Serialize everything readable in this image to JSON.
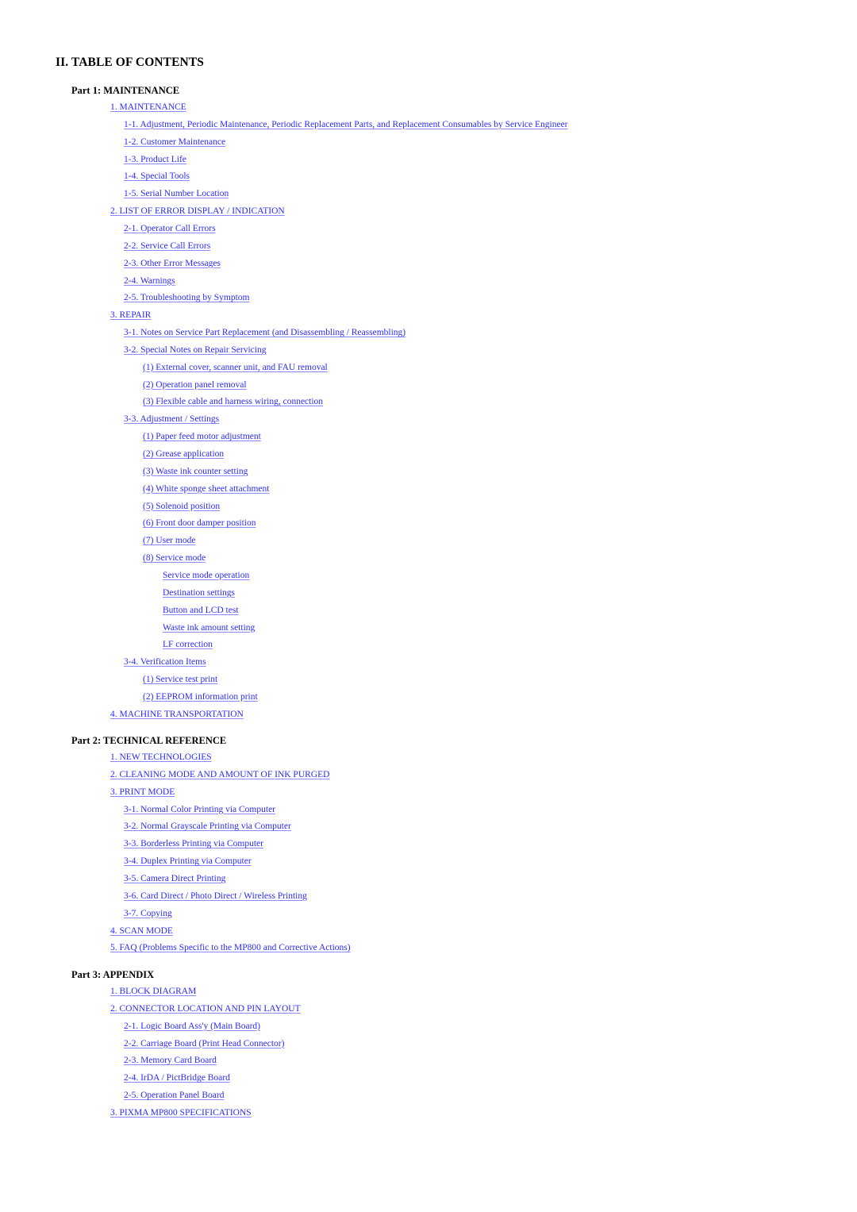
{
  "title": "II.  TABLE OF CONTENTS",
  "link_color": "#2a2aff",
  "parts": [
    {
      "label": "Part 1:  MAINTENANCE",
      "entries": [
        {
          "level": 1,
          "text": "1.  MAINTENANCE"
        },
        {
          "level": 2,
          "text": "1-1. Adjustment, Periodic Maintenance, Periodic Replacement Parts, and Replacement Consumables by Service Engineer"
        },
        {
          "level": 2,
          "text": "1-2.  Customer Maintenance"
        },
        {
          "level": 2,
          "text": "1-3.  Product Life"
        },
        {
          "level": 2,
          "text": "1-4.  Special Tools"
        },
        {
          "level": 2,
          "text": "1-5.  Serial Number Location"
        },
        {
          "level": 1,
          "text": "2.  LIST OF ERROR DISPLAY / INDICATION"
        },
        {
          "level": 2,
          "text": "2-1.  Operator Call Errors"
        },
        {
          "level": 2,
          "text": "2-2.  Service Call Errors"
        },
        {
          "level": 2,
          "text": "2-3.  Other Error Messages"
        },
        {
          "level": 2,
          "text": "2-4.  Warnings"
        },
        {
          "level": 2,
          "text": "2-5.  Troubleshooting by Symptom"
        },
        {
          "level": 1,
          "text": "3.  REPAIR"
        },
        {
          "level": 2,
          "text": "3-1.  Notes on Service Part Replacement (and Disassembling / Reassembling)"
        },
        {
          "level": 2,
          "text": "3-2.  Special Notes on Repair Servicing"
        },
        {
          "level": 3,
          "text": "(1)  External cover, scanner unit, and FAU removal"
        },
        {
          "level": 3,
          "text": "(2)  Operation panel removal"
        },
        {
          "level": 3,
          "text": "(3)  Flexible cable and harness wiring, connection"
        },
        {
          "level": 2,
          "text": "3-3.  Adjustment / Settings"
        },
        {
          "level": 3,
          "text": "(1)  Paper feed motor adjustment"
        },
        {
          "level": 3,
          "text": "(2)  Grease application"
        },
        {
          "level": 3,
          "text": "(3)  Waste ink counter setting"
        },
        {
          "level": 3,
          "text": "(4)  White sponge sheet attachment"
        },
        {
          "level": 3,
          "text": "(5)  Solenoid position"
        },
        {
          "level": 3,
          "text": "(6)  Front door damper position"
        },
        {
          "level": 3,
          "text": "(7)  User mode"
        },
        {
          "level": 3,
          "text": "(8)  Service mode"
        },
        {
          "level": 4,
          "text": "Service mode operation"
        },
        {
          "level": 4,
          "text": "Destination settings"
        },
        {
          "level": 4,
          "text": "Button and LCD test"
        },
        {
          "level": 4,
          "text": "Waste ink amount setting"
        },
        {
          "level": 4,
          "text": "LF correction"
        },
        {
          "level": 2,
          "text": "3-4.  Verification Items"
        },
        {
          "level": 3,
          "text": "(1)  Service test print"
        },
        {
          "level": 3,
          "text": "(2)  EEPROM information print"
        },
        {
          "level": 1,
          "text": "4.  MACHINE TRANSPORTATION"
        }
      ]
    },
    {
      "label": "Part 2:  TECHNICAL REFERENCE",
      "entries": [
        {
          "level": 1,
          "text": "1.  NEW TECHNOLOGIES"
        },
        {
          "level": 1,
          "text": "2.  CLEANING MODE AND AMOUNT OF INK PURGED"
        },
        {
          "level": 1,
          "text": "3.  PRINT MODE"
        },
        {
          "level": 2,
          "text": "3-1.  Normal Color Printing via Computer"
        },
        {
          "level": 2,
          "text": "3-2.  Normal Grayscale Printing via Computer"
        },
        {
          "level": 2,
          "text": "3-3.  Borderless Printing via Computer"
        },
        {
          "level": 2,
          "text": "3-4.  Duplex Printing via Computer"
        },
        {
          "level": 2,
          "text": "3-5.  Camera Direct Printing"
        },
        {
          "level": 2,
          "text": "3-6.  Card Direct / Photo Direct / Wireless Printing"
        },
        {
          "level": 2,
          "text": "3-7.  Copying"
        },
        {
          "level": 1,
          "text": "4.  SCAN MODE"
        },
        {
          "level": 1,
          "text": "5.  FAQ (Problems Specific to the MP800 and Corrective Actions)"
        }
      ]
    },
    {
      "label": "Part 3:  APPENDIX",
      "entries": [
        {
          "level": 1,
          "text": "1.  BLOCK DIAGRAM"
        },
        {
          "level": 1,
          "text": "2.  CONNECTOR LOCATION AND PIN LAYOUT"
        },
        {
          "level": 2,
          "text": "2-1.  Logic Board Ass'y (Main Board)"
        },
        {
          "level": 2,
          "text": "2-2.  Carriage Board (Print Head Connector)"
        },
        {
          "level": 2,
          "text": "2-3.  Memory Card Board"
        },
        {
          "level": 2,
          "text": "2-4.  IrDA / PictBridge Board"
        },
        {
          "level": 2,
          "text": "2-5.  Operation Panel Board"
        },
        {
          "level": 1,
          "text": "3.  PIXMA MP800 SPECIFICATIONS"
        }
      ]
    }
  ]
}
